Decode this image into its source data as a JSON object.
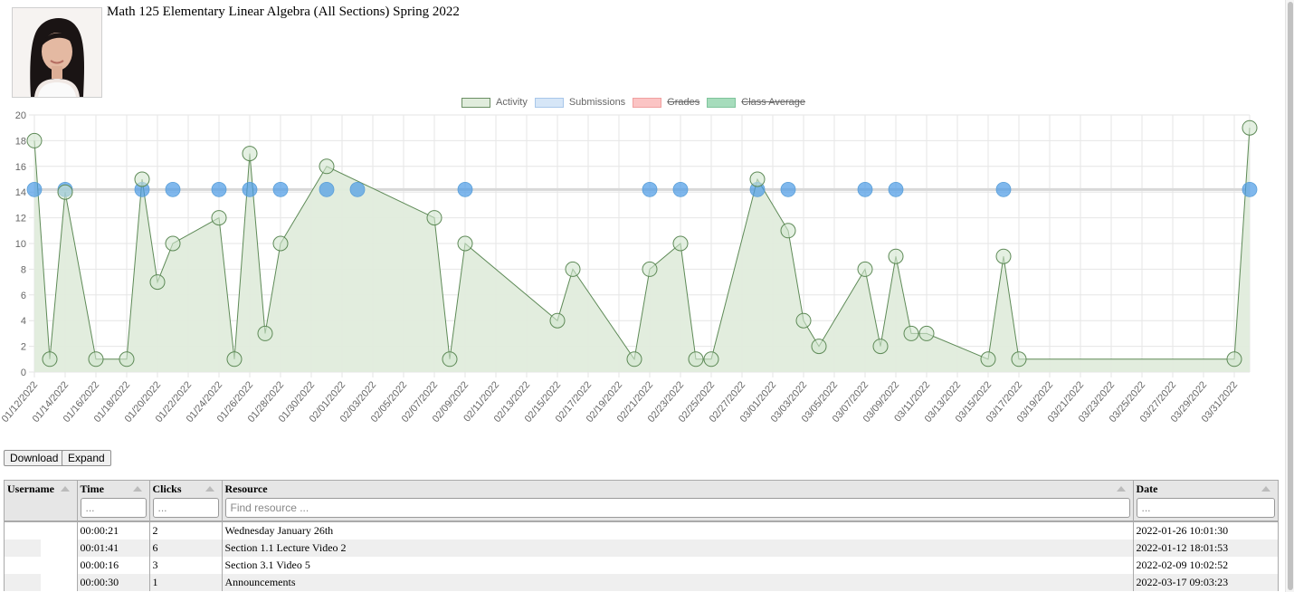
{
  "header": {
    "title": "Math 125 Elementary Linear Algebra (All Sections) Spring 2022",
    "avatar_icon": "person-photo"
  },
  "legend": [
    {
      "label": "Activity",
      "fill": "#e0ecdc",
      "stroke": "#6b8f64",
      "hidden": false
    },
    {
      "label": "Submissions",
      "fill": "#d6e6f7",
      "stroke": "#a8c7ea",
      "hidden": false
    },
    {
      "label": "Grades",
      "fill": "#fbc4c4",
      "stroke": "#f0a0a0",
      "hidden": true
    },
    {
      "label": "Class Average",
      "fill": "#a6dcbc",
      "stroke": "#7fc49c",
      "hidden": true
    }
  ],
  "chart_data": {
    "type": "line",
    "title": "",
    "xlabel": "",
    "ylabel": "",
    "ylim": [
      0,
      20
    ],
    "yticks": [
      0,
      2,
      4,
      6,
      8,
      10,
      12,
      14,
      16,
      18,
      20
    ],
    "xlim": [
      "2022-01-12",
      "2022-04-01"
    ],
    "grid": true,
    "legend_position": "top-center",
    "xtick_labels": [
      "01/12/2022",
      "01/14/2022",
      "01/16/2022",
      "01/18/2022",
      "01/20/2022",
      "01/22/2022",
      "01/24/2022",
      "01/26/2022",
      "01/28/2022",
      "01/30/2022",
      "02/01/2022",
      "02/03/2022",
      "02/05/2022",
      "02/07/2022",
      "02/09/2022",
      "02/11/2022",
      "02/13/2022",
      "02/15/2022",
      "02/17/2022",
      "02/19/2022",
      "02/21/2022",
      "02/23/2022",
      "02/25/2022",
      "02/27/2022",
      "03/01/2022",
      "03/03/2022",
      "03/05/2022",
      "03/07/2022",
      "03/09/2022",
      "03/11/2022",
      "03/13/2022",
      "03/15/2022",
      "03/17/2022",
      "03/19/2022",
      "03/21/2022",
      "03/23/2022",
      "03/25/2022",
      "03/27/2022",
      "03/29/2022",
      "03/31/2022"
    ],
    "reference_line": {
      "value": 14.2,
      "color": "#d8d8d8"
    },
    "series": [
      {
        "name": "Activity",
        "kind": "area-line",
        "color": "#5e8a57",
        "fill": "#e0ecdc",
        "points": [
          [
            "2022-01-12",
            18
          ],
          [
            "2022-01-13",
            1
          ],
          [
            "2022-01-14",
            14
          ],
          [
            "2022-01-16",
            1
          ],
          [
            "2022-01-18",
            1
          ],
          [
            "2022-01-19",
            15
          ],
          [
            "2022-01-20",
            7
          ],
          [
            "2022-01-21",
            10
          ],
          [
            "2022-01-24",
            12
          ],
          [
            "2022-01-25",
            1
          ],
          [
            "2022-01-26",
            17
          ],
          [
            "2022-01-27",
            3
          ],
          [
            "2022-01-28",
            10
          ],
          [
            "2022-01-31",
            16
          ],
          [
            "2022-02-07",
            12
          ],
          [
            "2022-02-08",
            1
          ],
          [
            "2022-02-09",
            10
          ],
          [
            "2022-02-15",
            4
          ],
          [
            "2022-02-16",
            8
          ],
          [
            "2022-02-20",
            1
          ],
          [
            "2022-02-21",
            8
          ],
          [
            "2022-02-23",
            10
          ],
          [
            "2022-02-24",
            1
          ],
          [
            "2022-02-25",
            1
          ],
          [
            "2022-02-28",
            15
          ],
          [
            "2022-03-02",
            11
          ],
          [
            "2022-03-03",
            4
          ],
          [
            "2022-03-04",
            2
          ],
          [
            "2022-03-07",
            8
          ],
          [
            "2022-03-08",
            2
          ],
          [
            "2022-03-09",
            9
          ],
          [
            "2022-03-10",
            3
          ],
          [
            "2022-03-11",
            3
          ],
          [
            "2022-03-15",
            1
          ],
          [
            "2022-03-16",
            9
          ],
          [
            "2022-03-17",
            1
          ],
          [
            "2022-03-31",
            1
          ],
          [
            "2022-04-01",
            19
          ]
        ]
      },
      {
        "name": "Submissions",
        "kind": "scatter",
        "color": "#4a9ae6",
        "value": 14.2,
        "dates": [
          "2022-01-12",
          "2022-01-14",
          "2022-01-19",
          "2022-01-21",
          "2022-01-24",
          "2022-01-26",
          "2022-01-28",
          "2022-01-31",
          "2022-02-02",
          "2022-02-09",
          "2022-02-21",
          "2022-02-23",
          "2022-02-28",
          "2022-03-02",
          "2022-03-07",
          "2022-03-09",
          "2022-03-16",
          "2022-04-01"
        ]
      }
    ]
  },
  "toolbar": {
    "download_label": "Download",
    "expand_label": "Expand"
  },
  "table": {
    "columns": [
      {
        "label": "Username",
        "filter": null
      },
      {
        "label": "Time",
        "filter": "..."
      },
      {
        "label": "Clicks",
        "filter": "..."
      },
      {
        "label": "Resource",
        "filter": "Find resource ..."
      },
      {
        "label": "Date",
        "filter": "..."
      }
    ],
    "rows": [
      {
        "username": "",
        "time": "00:00:21",
        "clicks": "2",
        "resource": "Wednesday January 26th",
        "date": "2022-01-26 10:01:30"
      },
      {
        "username": "",
        "time": "00:01:41",
        "clicks": "6",
        "resource": "Section 1.1 Lecture Video 2",
        "date": "2022-01-12 18:01:53"
      },
      {
        "username": "",
        "time": "00:00:16",
        "clicks": "3",
        "resource": "Section 3.1 Video 5",
        "date": "2022-02-09 10:02:52"
      },
      {
        "username": "",
        "time": "00:00:30",
        "clicks": "1",
        "resource": "Announcements",
        "date": "2022-03-17 09:03:23"
      }
    ]
  }
}
